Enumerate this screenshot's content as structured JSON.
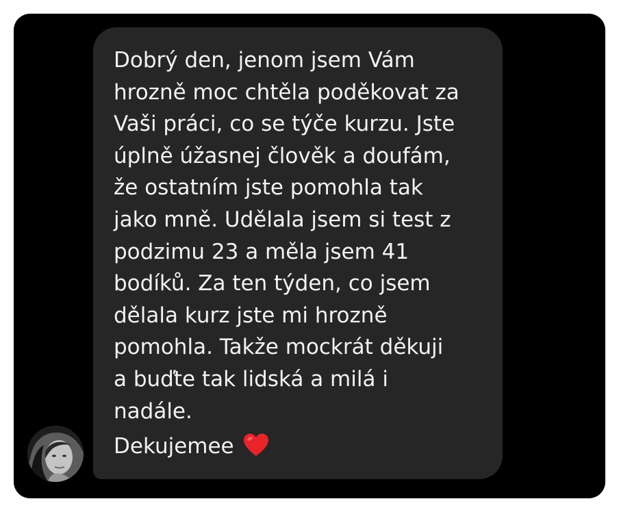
{
  "message": {
    "body_lines": [
      "Dobrý den, jenom jsem Vám",
      "hrozně moc chtěla poděkovat za",
      "Vaši práci, co se týče kurzu. Jste",
      "úplně úžasnej člověk a doufám,",
      "že ostatním jste pomohla tak",
      "jako mně. Udělala jsem si test z",
      "podzimu 23 a měla jsem 41",
      "bodíků. Za ten týden, co jsem",
      "dělala kurz jste mi hrozně",
      "pomohla. Takže mockrát děkuji",
      "a buďte tak lidská a milá i",
      "nadále."
    ],
    "closing": "Dekujemee",
    "closing_emoji": "heart-emoji"
  },
  "sender": {
    "avatar": "profile-photo-grayscale"
  },
  "colors": {
    "page_background": "#ffffff",
    "chat_background": "#000000",
    "bubble_background": "#262626",
    "text": "#f2f2f2",
    "heart": "#e8242a"
  }
}
